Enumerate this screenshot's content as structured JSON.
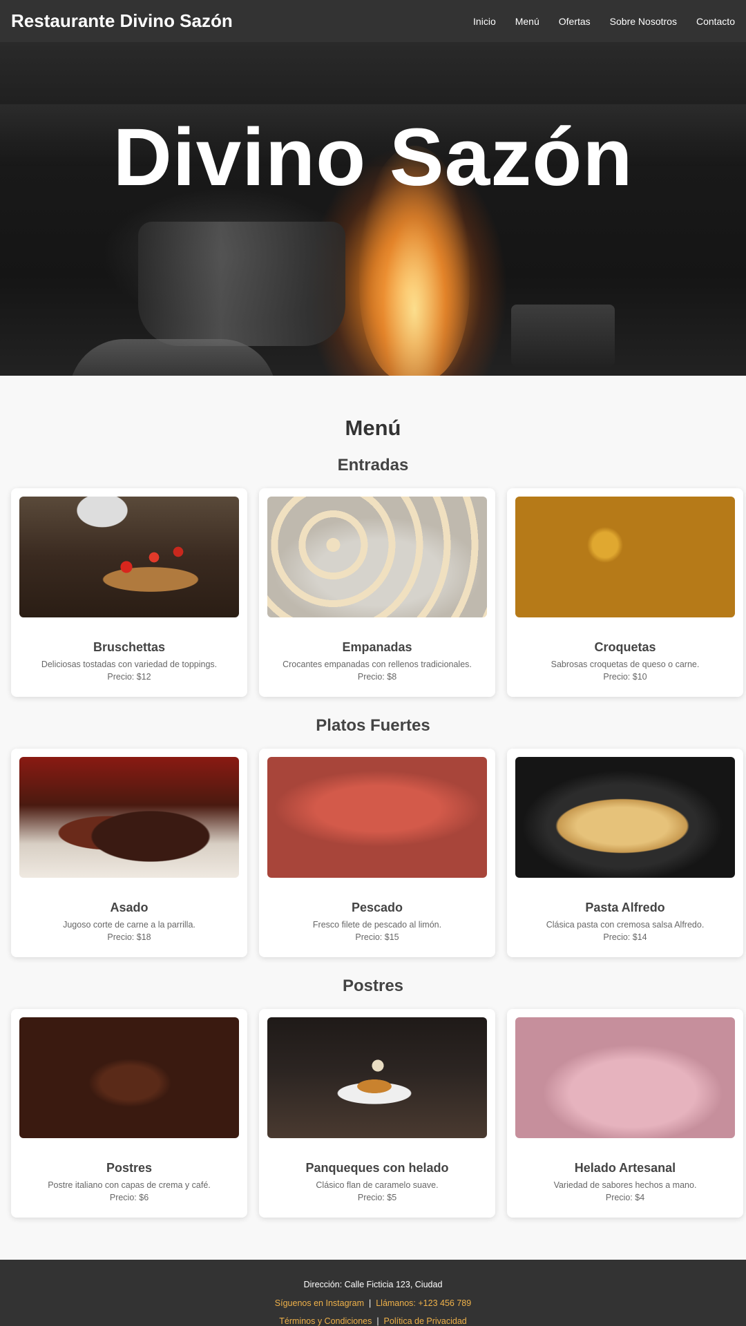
{
  "navbar": {
    "brand": "Restaurante Divino Sazón",
    "links": [
      "Inicio",
      "Menú",
      "Ofertas",
      "Sobre Nosotros",
      "Contacto"
    ]
  },
  "hero": {
    "title": "Divino Sazón"
  },
  "menu": {
    "title": "Menú",
    "categories": [
      {
        "title": "Entradas",
        "items": [
          {
            "name": "Bruschettas",
            "description": "Deliciosas tostadas con variedad de toppings.",
            "price": "Precio: $12"
          },
          {
            "name": "Empanadas",
            "description": "Crocantes empanadas con rellenos tradicionales.",
            "price": "Precio: $8"
          },
          {
            "name": "Croquetas",
            "description": "Sabrosas croquetas de queso o carne.",
            "price": "Precio: $10"
          }
        ]
      },
      {
        "title": "Platos Fuertes",
        "items": [
          {
            "name": "Asado",
            "description": "Jugoso corte de carne a la parrilla.",
            "price": "Precio: $18"
          },
          {
            "name": "Pescado",
            "description": "Fresco filete de pescado al limón.",
            "price": "Precio: $15"
          },
          {
            "name": "Pasta Alfredo",
            "description": "Clásica pasta con cremosa salsa Alfredo.",
            "price": "Precio: $14"
          }
        ]
      },
      {
        "title": "Postres",
        "items": [
          {
            "name": "Postres",
            "description": "Postre italiano con capas de crema y café.",
            "price": "Precio: $6"
          },
          {
            "name": "Panqueques con helado",
            "description": "Clásico flan de caramelo suave.",
            "price": "Precio: $5"
          },
          {
            "name": "Helado Artesanal",
            "description": "Variedad de sabores hechos a mano.",
            "price": "Precio: $4"
          }
        ]
      }
    ]
  },
  "footer": {
    "address": "Dirección: Calle Ficticia 123, Ciudad",
    "instagram": "Síguenos en Instagram",
    "phone": "Llámanos: +123 456 789",
    "terms": "Términos y Condiciones",
    "privacy": "Política de Privacidad",
    "separator": "|"
  },
  "colors": {
    "navbar_bg": "#333333",
    "page_bg": "#f8f8f8",
    "footer_link": "#f0b24a"
  }
}
